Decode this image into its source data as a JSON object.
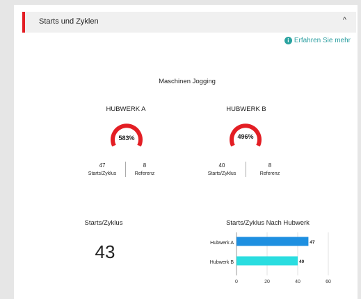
{
  "section": {
    "title": "Starts und Zyklen",
    "chevron": "^"
  },
  "learn_more": {
    "label": "Erfahren Sie mehr",
    "icon": "info-icon"
  },
  "jogging": {
    "title": "Maschinen Jogging",
    "hubwerks": [
      {
        "name": "HUBWERK A",
        "percent": "583%",
        "starts": "47",
        "starts_label": "Starts/Zyklus",
        "ref": "8",
        "ref_label": "Referenz"
      },
      {
        "name": "HUBWERK B",
        "percent": "496%",
        "starts": "40",
        "starts_label": "Starts/Zyklus",
        "ref": "8",
        "ref_label": "Referenz"
      }
    ]
  },
  "starts_zyklus": {
    "title": "Starts/Zyklus",
    "value": "43"
  },
  "colors": {
    "accent": "#e31e24",
    "gauge": "#e31e24",
    "barA": "#1e8fe0",
    "barB": "#2adde0",
    "link": "#2a9ea0"
  },
  "chart_data": {
    "type": "bar",
    "orientation": "horizontal",
    "title": "Starts/Zyklus Nach Hubwerk",
    "categories": [
      "Hubwerk A",
      "Hubwerk B"
    ],
    "values": [
      47,
      40
    ],
    "data_labels": [
      "47",
      "40"
    ],
    "xlim": [
      0,
      60
    ],
    "xticks": [
      "0",
      "20",
      "40",
      "60"
    ],
    "grid": true
  }
}
